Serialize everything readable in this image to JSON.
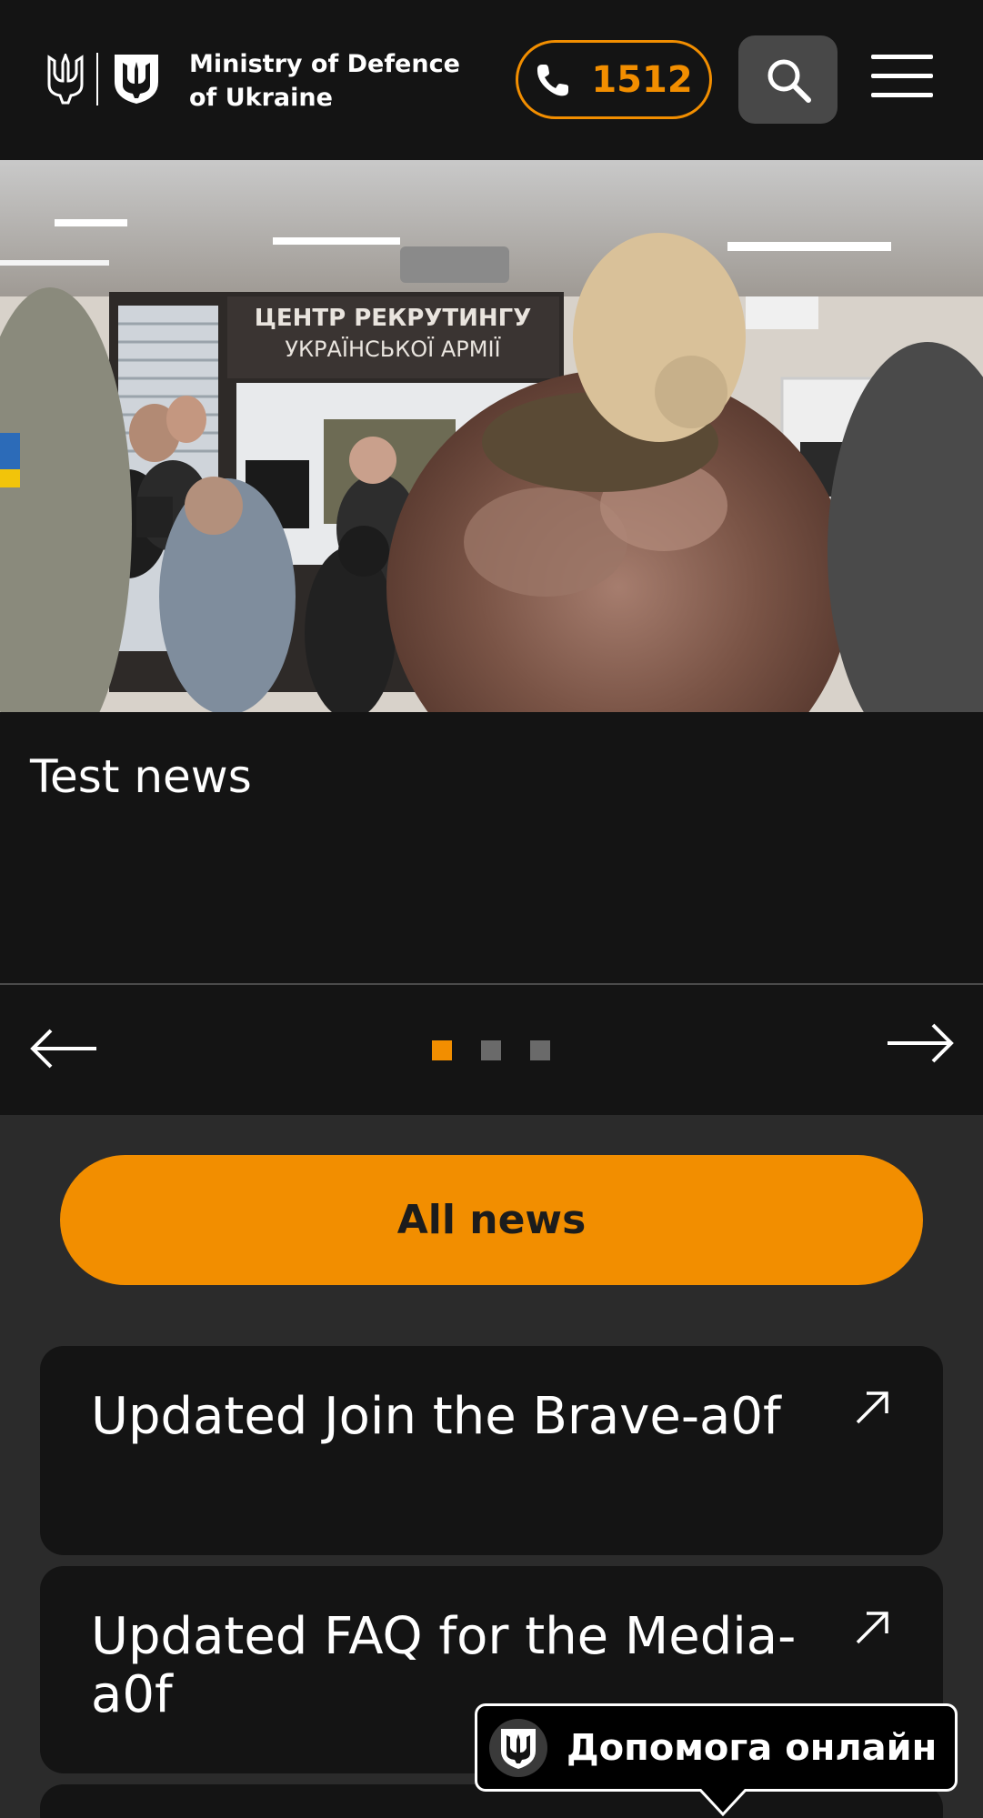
{
  "header": {
    "org_name_line1": "Ministry of Defence",
    "org_name_line2": "of Ukraine",
    "hotline_number": "1512"
  },
  "hero": {
    "image_sign_line1": "ЦЕНТР РЕКРУТИНГУ",
    "image_sign_line2": "УКРАЇНСЬКОЇ АРМІЇ",
    "news_title": "Test news",
    "slides_total": 3,
    "slide_active_index": 0
  },
  "main": {
    "all_news_label": "All news",
    "cards": [
      {
        "title": "Updated Join the Brave-a0f"
      },
      {
        "title": "Updated FAQ for the Media-a0f"
      }
    ]
  },
  "help_chip": {
    "label": "Допомога онлайн"
  },
  "colors": {
    "accent": "#f28e00",
    "header_bg": "#141414",
    "page_bg": "#2b2b2b"
  }
}
